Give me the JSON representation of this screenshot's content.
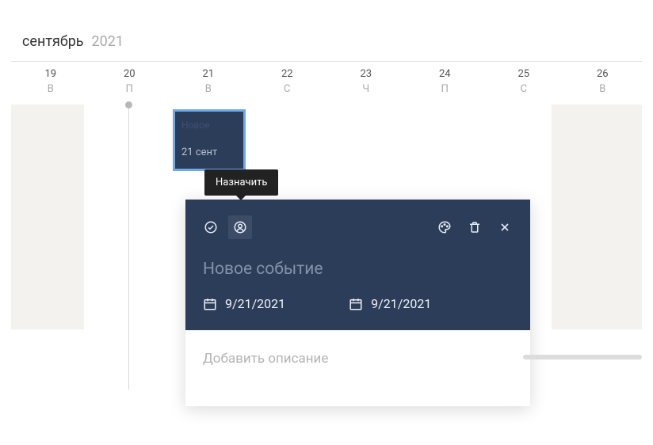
{
  "header": {
    "month": "сентябрь",
    "year": "2021"
  },
  "days": [
    {
      "num": "19",
      "dow": "В"
    },
    {
      "num": "20",
      "dow": "П"
    },
    {
      "num": "21",
      "dow": "В"
    },
    {
      "num": "22",
      "dow": "С"
    },
    {
      "num": "23",
      "dow": "Ч"
    },
    {
      "num": "24",
      "dow": "П"
    },
    {
      "num": "25",
      "dow": "С"
    },
    {
      "num": "26",
      "dow": "В"
    }
  ],
  "event_chip": {
    "title": "Новое",
    "date": "21 сент"
  },
  "tooltip": {
    "label": "Назначить"
  },
  "popover": {
    "title": "Новое событие",
    "start_date": "9/21/2021",
    "end_date": "9/21/2021",
    "description_placeholder": "Добавить описание",
    "description_value": ""
  }
}
